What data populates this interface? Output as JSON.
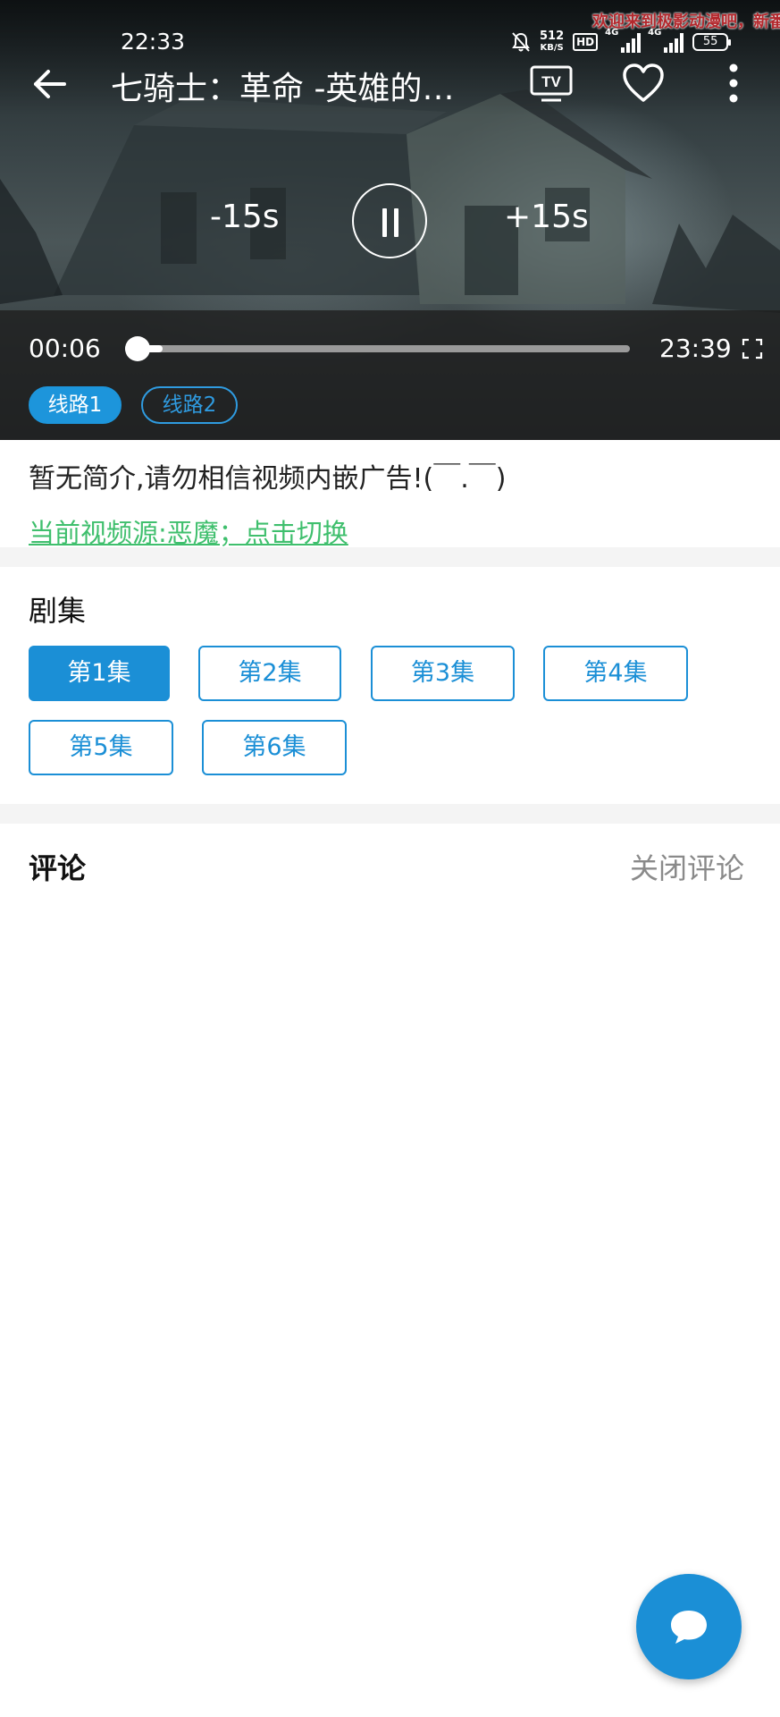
{
  "status_bar": {
    "time": "22:33",
    "net_speed_value": "512",
    "net_speed_unit": "KB/S",
    "hd_badge": "HD",
    "signal_1_label": "4G",
    "signal_2_label": "4G",
    "battery": "55",
    "icons": [
      "bell-muted-icon",
      "signal-icon",
      "battery-icon"
    ]
  },
  "danmaku": {
    "text": "欢迎来到极影动漫吧，新番"
  },
  "player": {
    "title": "七骑士：革命 -英雄的继承者-",
    "seek_back_label": "-15s",
    "seek_forward_label": "+15s",
    "current_time": "00:06",
    "total_time": "23:39",
    "progress_fraction": 0.0043,
    "buffered_fraction": 0.075,
    "lines": [
      {
        "label": "线路1",
        "active": true
      },
      {
        "label": "线路2",
        "active": false
      }
    ],
    "icons": [
      "back-arrow-icon",
      "tv-cast-icon",
      "heart-icon",
      "more-vertical-icon",
      "pause-icon",
      "fullscreen-icon"
    ]
  },
  "description": {
    "text": "暂无简介,请勿相信视频内嵌广告!(￣.￣)",
    "source_link": "当前视频源:恶魔；点击切换"
  },
  "episodes": {
    "title": "剧集",
    "items": [
      {
        "label": "第1集",
        "active": true
      },
      {
        "label": "第2集",
        "active": false
      },
      {
        "label": "第3集",
        "active": false
      },
      {
        "label": "第4集",
        "active": false
      },
      {
        "label": "第5集",
        "active": false
      },
      {
        "label": "第6集",
        "active": false
      }
    ]
  },
  "comments": {
    "title": "评论",
    "close_label": "关闭评论"
  },
  "fab": {
    "icon": "chat-bubble-icon"
  },
  "colors": {
    "accent": "#1b8fd6",
    "link_green": "#3fbf6d",
    "separator": "#f4f4f4"
  }
}
